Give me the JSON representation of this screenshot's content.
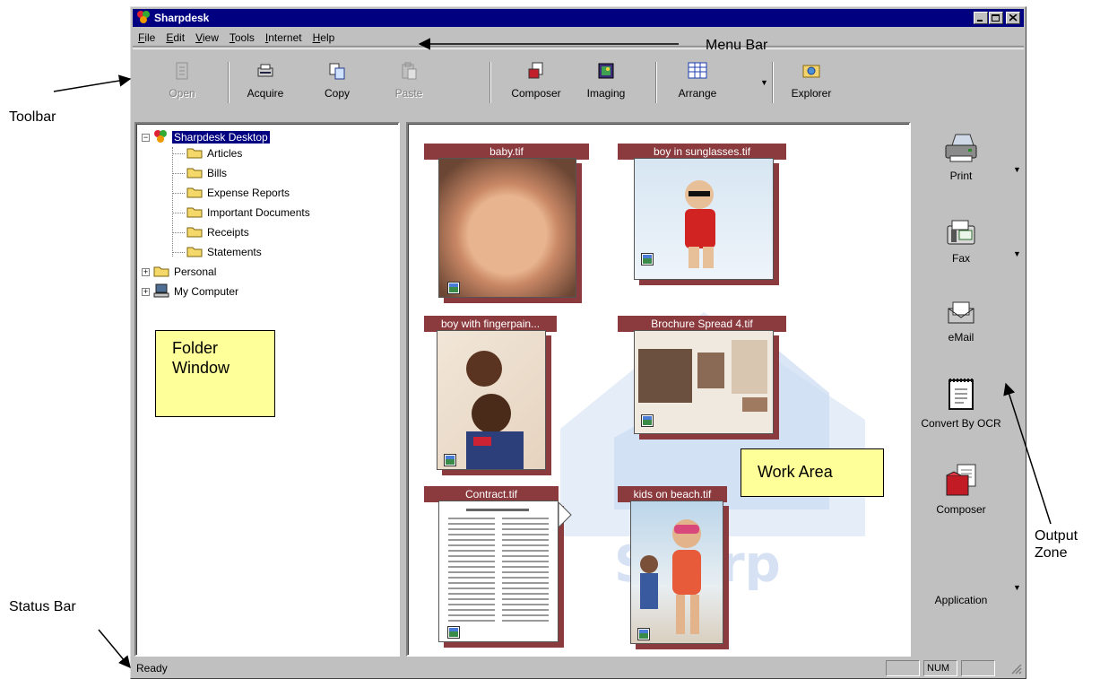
{
  "window": {
    "title": "Sharpdesk"
  },
  "menu": [
    "File",
    "Edit",
    "View",
    "Tools",
    "Internet",
    "Help"
  ],
  "toolbar": {
    "open": "Open",
    "acquire": "Acquire",
    "copy": "Copy",
    "paste": "Paste",
    "composer": "Composer",
    "imaging": "Imaging",
    "arrange": "Arrange",
    "explorer": "Explorer"
  },
  "tree": {
    "root": "Sharpdesk Desktop",
    "children": [
      "Articles",
      "Bills",
      "Expense Reports",
      "Important Documents",
      "Receipts",
      "Statements"
    ],
    "personal": "Personal",
    "my_computer": "My Computer"
  },
  "thumbnails": [
    "baby.tif",
    "boy in sunglasses.tif",
    "boy with fingerpain...",
    "Brochure Spread 4.tif",
    "Contract.tif",
    "kids on beach.tif"
  ],
  "output": {
    "print": "Print",
    "fax": "Fax",
    "email": "eMail",
    "ocr": "Convert By OCR",
    "composer": "Composer",
    "application": "Application"
  },
  "status": {
    "text": "Ready",
    "num": "NUM"
  },
  "callouts": {
    "menu_bar": "Menu Bar",
    "toolbar": "Toolbar",
    "folder_window": "Folder Window",
    "work_area": "Work Area",
    "output_zone": "Output Zone",
    "status_bar": "Status Bar"
  },
  "colors": {
    "titlebar": "#000080",
    "window_face": "#c0c0c0",
    "thumb_label": "#8b3a3e",
    "note": "#ffff99"
  }
}
